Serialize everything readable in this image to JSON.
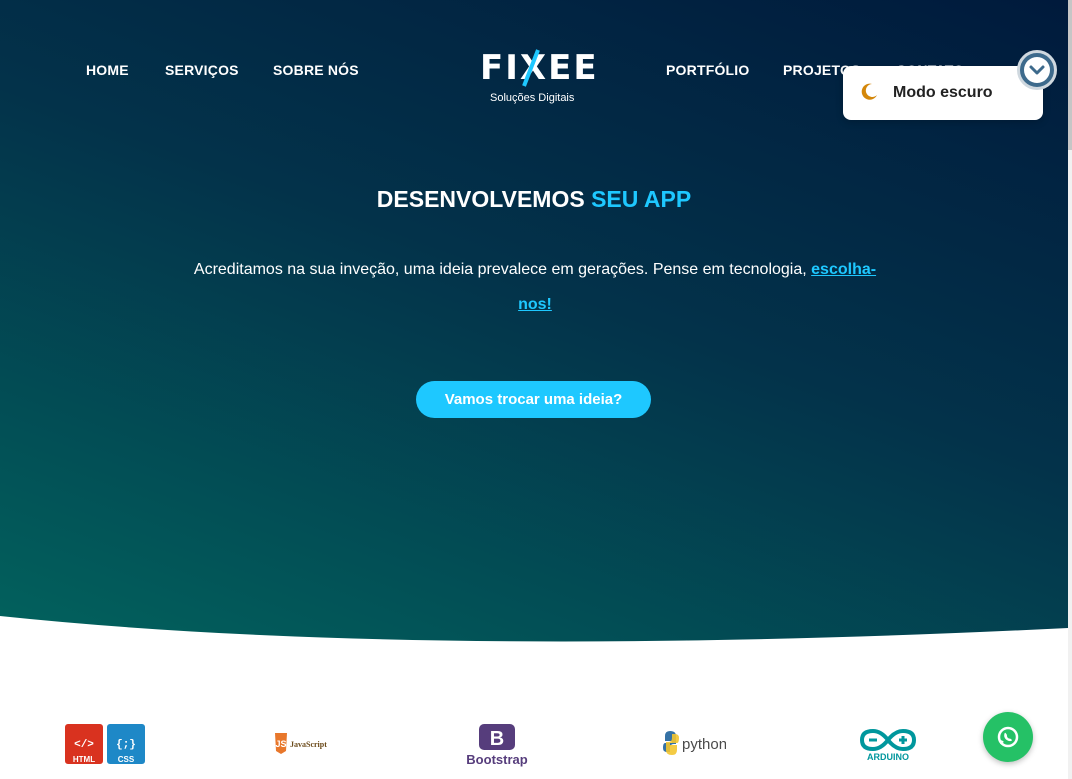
{
  "nav": {
    "left": [
      "HOME",
      "SERVIÇOS",
      "SOBRE NÓS"
    ],
    "right": [
      "PORTFÓLIO",
      "PROJETOS",
      "CONTATO"
    ]
  },
  "logo": {
    "name": "FIXEE",
    "tagline": "Soluções Digitais"
  },
  "hero": {
    "title_main": "DESENVOLVEMOS",
    "title_accent": "SEU APP",
    "text": "Acreditamos na sua inveção, uma ideia prevalece em gerações. Pense em tecnologia,",
    "link": "escolha-nos!",
    "cta": "Vamos trocar uma ideia?"
  },
  "dark_mode": {
    "label": "Modo escuro",
    "icon": "moon-icon"
  },
  "tech_logos": [
    {
      "name": "html-css-logo",
      "labels": [
        "HTML",
        "CSS"
      ]
    },
    {
      "name": "javascript-logo",
      "labels": [
        "JavaScript"
      ]
    },
    {
      "name": "bootstrap-logo",
      "labels": [
        "Bootstrap"
      ]
    },
    {
      "name": "python-logo",
      "labels": [
        "python"
      ]
    },
    {
      "name": "arduino-logo",
      "labels": [
        "ARDUINO"
      ]
    }
  ],
  "colors": {
    "accent": "#1ec8ff",
    "hero_dark": "#001a3c",
    "hero_teal": "#02645e",
    "whatsapp": "#25c166"
  }
}
